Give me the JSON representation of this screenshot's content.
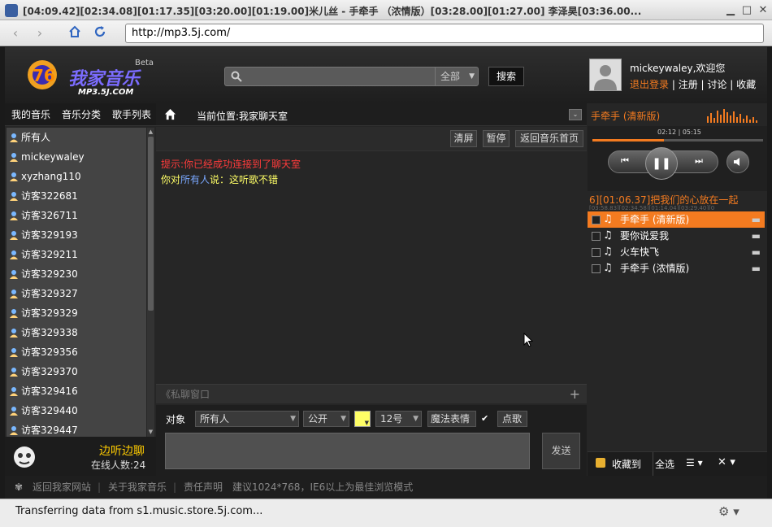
{
  "window": {
    "title": "[04:09.42][02:34.08][01:17.35][03:20.00][01:19.00]米儿丝 - 手牵手 （浓情版）[03:28.00][01:27.00] 李泽昊[03:36.00..."
  },
  "browser": {
    "url": "http://mp3.5j.com/",
    "status": "Transferring data from s1.music.store.5j.com..."
  },
  "header": {
    "logo_text": "我家音乐",
    "logo_sub": "MP3.5J.COM",
    "logo_beta": "Beta",
    "search_placeholder": "",
    "search_scope": "全部",
    "search_button": "搜索",
    "welcome": "mickeywaley,欢迎您",
    "logout": "退出登录",
    "register": "注册",
    "discuss": "讨论",
    "favorites": "收藏"
  },
  "left": {
    "tabs": [
      "我的音乐",
      "音乐分类",
      "歌手列表"
    ],
    "users": [
      "所有人",
      "mickeywaley",
      "xyzhang110",
      "访客322681",
      "访客326711",
      "访客329193",
      "访客329211",
      "访客329230",
      "访客329327",
      "访客329329",
      "访客329338",
      "访客329356",
      "访客329370",
      "访客329416",
      "访客329440",
      "访客329447"
    ],
    "chat_title": "边听边聊",
    "online_count": "在线人数:24"
  },
  "center": {
    "location": "当前位置:我家聊天室",
    "buttons": {
      "clear": "清屏",
      "pause": "暂停",
      "back": "返回音乐首页"
    },
    "messages": {
      "system": "提示:你已经成功连接到了聊天室",
      "m1_prefix": "你对",
      "m1_target": "所有人",
      "m1_say": "说：",
      "m1_text": "这听歌不错"
    },
    "private_window": "《私聊窗口",
    "input": {
      "target_label": "对象",
      "target_value": "所有人",
      "mode_value": "公开",
      "size_value": "12号",
      "emoji_button": "魔法表情",
      "request_button": "点歌",
      "send_button": "发送"
    }
  },
  "player": {
    "now_playing": "手牵手 (清新版)",
    "time": "02:12 | 05:15",
    "progress": 0.42,
    "lyric": "6][01:06.37]把我们的心放在一起",
    "lyric2": "[03:58.83][02:34.58][01:14.04][03:29.40][0",
    "playlist": [
      "手牵手 (清新版)",
      "要你说爱我",
      "火车快飞",
      "手牵手 (浓情版)"
    ],
    "bottom": {
      "collect": "收藏到",
      "select_all": "全选"
    }
  },
  "footer": {
    "links": [
      "返回我家网站",
      "关于我家音乐",
      "责任声明"
    ],
    "note": "建议1024*768，IE6以上为最佳浏览模式"
  },
  "colors": {
    "accent": "#f47b20",
    "system_msg": "#ff3b3b",
    "username_blue": "#7aa8ff",
    "msg_text": "#ffff66"
  }
}
